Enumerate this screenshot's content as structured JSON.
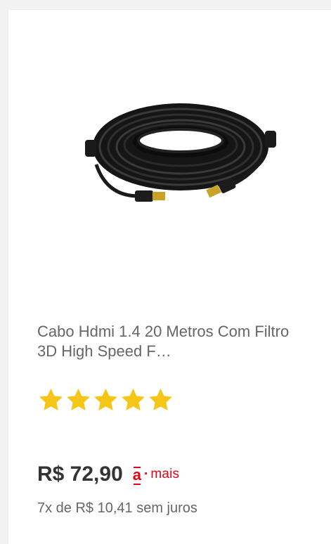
{
  "product": {
    "title": "Cabo Hdmi 1.4 20 Metros Com Filtro 3D High Speed F…",
    "image_alt": "cabo-hdmi-image",
    "rating": 5,
    "rating_max": 5,
    "price": "R$ 72,90",
    "installments": "7x de R$ 10,41 sem juros"
  },
  "badge": {
    "a": "a",
    "dot": "·",
    "mais": "mais"
  },
  "colors": {
    "star": "#f5c518",
    "badge_red": "#e60014",
    "price": "#333333",
    "text_gray": "#666666"
  }
}
